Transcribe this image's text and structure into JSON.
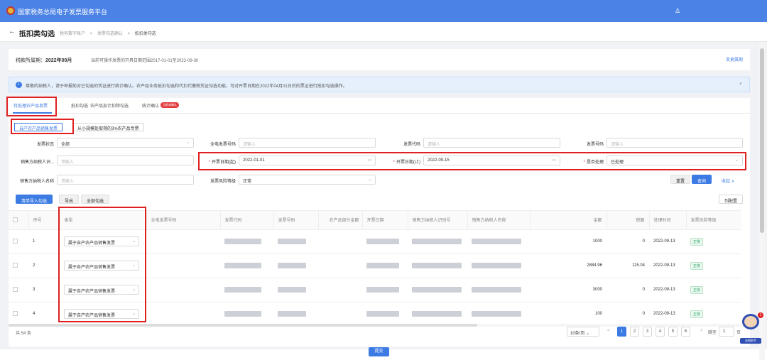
{
  "app": {
    "title": "国家税务总局电子发票服务平台",
    "user_icon": "user-icon"
  },
  "header": {
    "back": "←",
    "title": "抵扣类勾选",
    "breadcrumbs": [
      "税务数字账户",
      ">",
      "发票勾选确认",
      ">",
      "抵扣类勾选"
    ]
  },
  "period": {
    "label_prefix": "税款所属期：",
    "period_value": "2022年09月",
    "desc": "当前可操作发票的开具日期范围2017-01-01至2022-09-30",
    "change_link": "变更属期"
  },
  "notice": {
    "icon": "i",
    "text": "尊敬的纳税人，请于申报前对已勾选的凭证进行统计确认。农产品业务抵扣勾选和代扣代缴税凭证勾选功能，可对开票日期在2022年04月01日后的票证进行抵扣勾选操作。",
    "close": "×"
  },
  "tabs": [
    "待处理农产品发票",
    "抵扣勾选",
    "农产品加计扣除勾选",
    "统计确认"
  ],
  "tab_badge": "当前未确认",
  "subtabs": [
    "自产农产品销售发票",
    "从小规模处取得的3%农产品专票"
  ],
  "filters": {
    "status_label": "发票状态",
    "status_value": "全部",
    "fullno_label": "全电发票号码",
    "fullno_ph": "请输入",
    "code_label": "发票代码",
    "code_ph": "请输入",
    "no_label": "发票号码",
    "no_ph": "请输入",
    "seller_id_label": "销售方纳税人识...",
    "seller_id_ph": "请输入",
    "date_start_label": "开票日期(起)",
    "date_start": "2022-01-01",
    "date_end_label": "开票日期(止)",
    "date_end": "2022-09-15",
    "processed_label": "是否处理",
    "processed_value": "已处理",
    "seller_name_label": "销售方纳税人名称",
    "seller_name_ph": "请输入",
    "risk_label": "发票风险等级",
    "risk_value": "正常",
    "req": "*"
  },
  "actions": {
    "reset": "重置",
    "query": "查询",
    "collapse": "收起 ∧",
    "import": "清单导入勾选",
    "export": "导出",
    "select_all": "全部勾选",
    "columns": "列配置"
  },
  "table": {
    "headers": [
      "序号",
      "类型",
      "全电发票号码",
      "发票代码",
      "发票号码",
      "农产品部分金额",
      "开票日期",
      "销售方纳税人识别号",
      "销售方纳税人名称",
      "金额",
      "税额",
      "处理时间",
      "发票风险等级"
    ],
    "rows": [
      {
        "idx": "1",
        "type": "属于自产农产品销售发票",
        "amount": "1000",
        "tax": "0",
        "time": "2022-09-13",
        "risk": "正常"
      },
      {
        "idx": "2",
        "type": "属于自产农产品销售发票",
        "amount": "2884.96",
        "tax": "115.04",
        "time": "2022-09-13",
        "risk": "正常"
      },
      {
        "idx": "3",
        "type": "属于自产农产品销售发票",
        "amount": "3000",
        "tax": "0",
        "time": "2022-09-13",
        "risk": "正常"
      },
      {
        "idx": "4",
        "type": "属于自产农产品销售发票",
        "amount": "100",
        "tax": "0",
        "time": "2022-09-13",
        "risk": "正常"
      }
    ]
  },
  "pagination": {
    "total": "共 54 条",
    "size": "10条/页 ⌄",
    "prev": "<",
    "pages": [
      "1",
      "2",
      "3",
      "4",
      "5",
      "6"
    ],
    "next": ">",
    "goto": "跳至",
    "goto_value": "1",
    "page_unit": "页"
  },
  "submit": "提交",
  "assistant": {
    "badge": "1",
    "label": "金税助手"
  }
}
